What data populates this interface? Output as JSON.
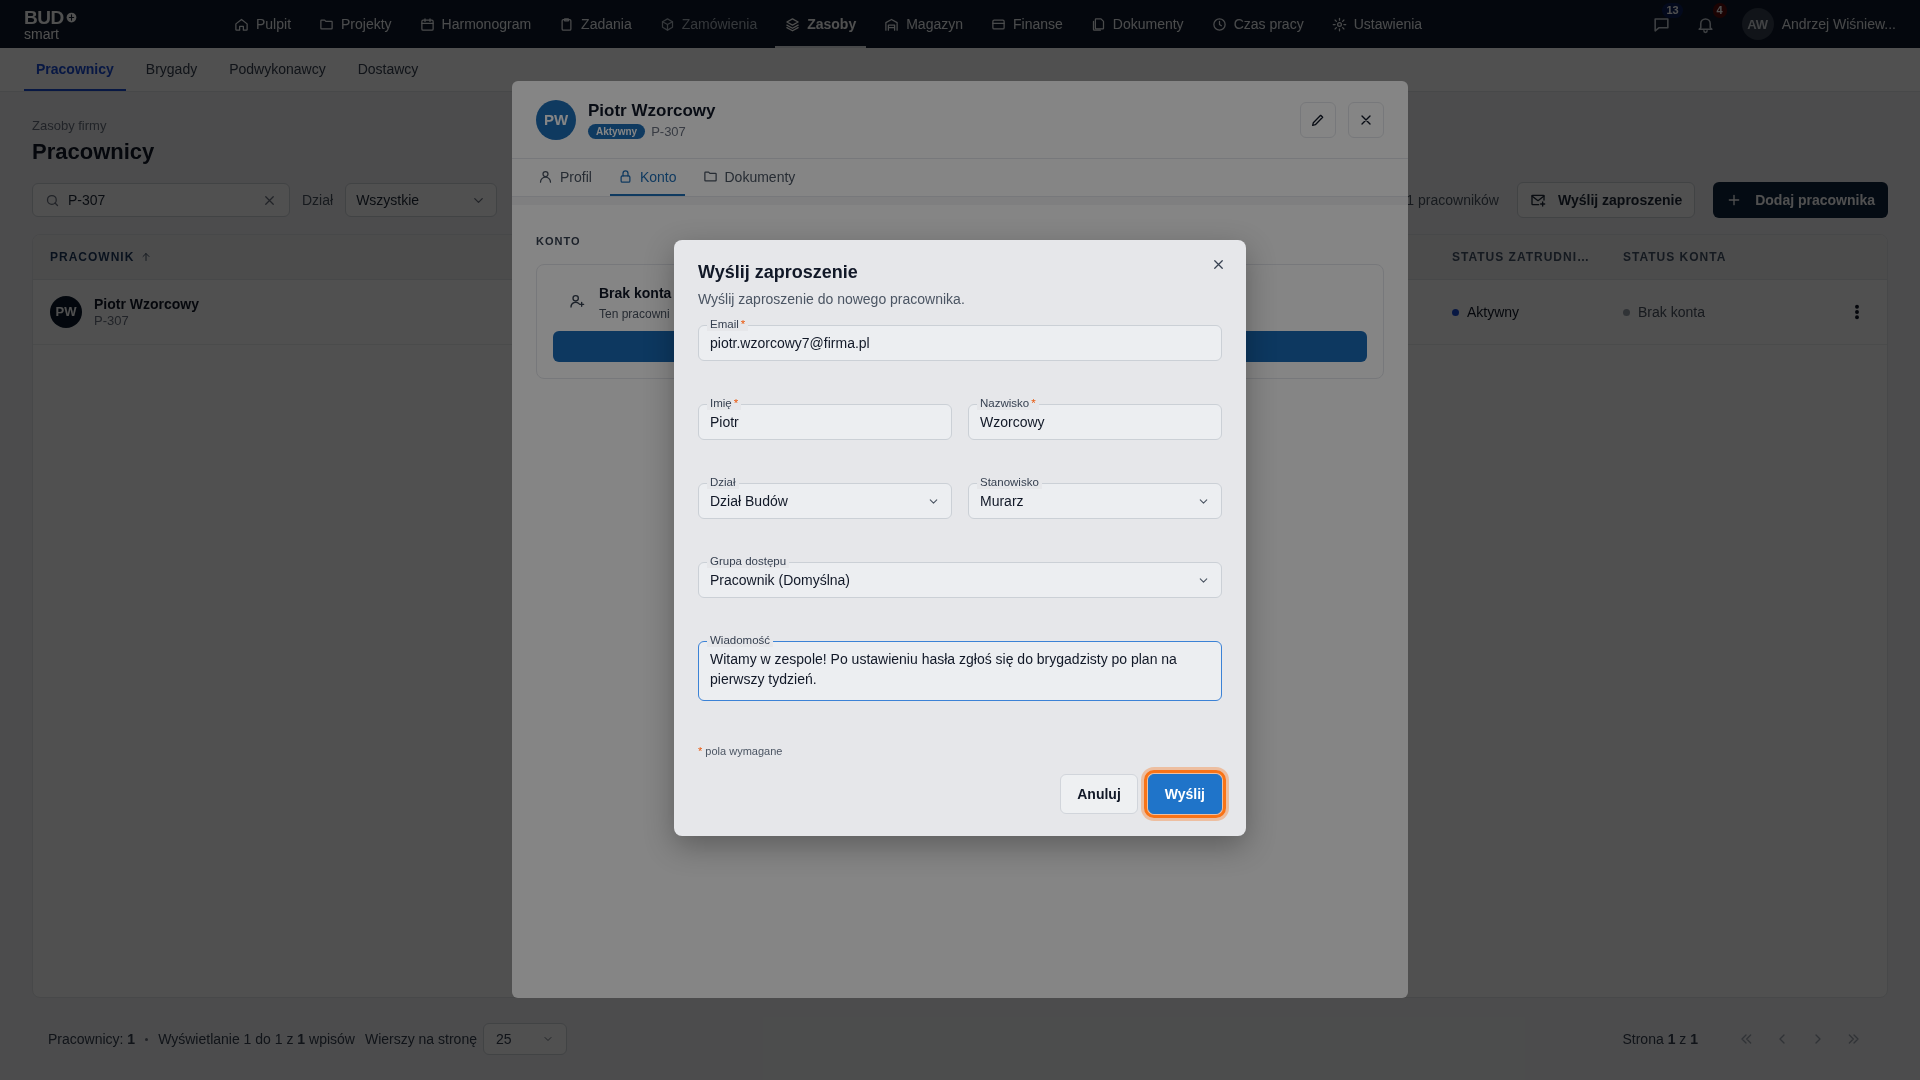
{
  "nav": {
    "logo_top": "BUD",
    "logo_bottom": "smart",
    "items": [
      {
        "label": "Pulpit",
        "selected": false,
        "disabled": false
      },
      {
        "label": "Projekty",
        "selected": false,
        "disabled": false
      },
      {
        "label": "Harmonogram",
        "selected": false,
        "disabled": false
      },
      {
        "label": "Zadania",
        "selected": false,
        "disabled": false
      },
      {
        "label": "Zamówienia",
        "selected": false,
        "disabled": true
      },
      {
        "label": "Zasoby",
        "selected": true,
        "disabled": false
      },
      {
        "label": "Magazyn",
        "selected": false,
        "disabled": false
      },
      {
        "label": "Finanse",
        "selected": false,
        "disabled": false
      },
      {
        "label": "Dokumenty",
        "selected": false,
        "disabled": false
      },
      {
        "label": "Czas pracy",
        "selected": false,
        "disabled": false
      },
      {
        "label": "Ustawienia",
        "selected": false,
        "disabled": false
      }
    ],
    "messages_count": "13",
    "notifications_count": "4",
    "user_initials": "AW",
    "user_name": "Andrzej Wiśniew..."
  },
  "subtabs": [
    {
      "label": "Pracownicy",
      "selected": true
    },
    {
      "label": "Brygady",
      "selected": false
    },
    {
      "label": "Podwykonawcy",
      "selected": false
    },
    {
      "label": "Dostawcy",
      "selected": false
    }
  ],
  "page": {
    "breadcrumb": "Zasoby firmy",
    "title": "Pracownicy",
    "search_value": "P-307",
    "filter_label": "Dział",
    "filter_value": "Wszystkie",
    "count": "1 pracowników",
    "invite_button": "Wyślij zaproszenie",
    "add_button": "Dodaj pracownika"
  },
  "table": {
    "columns": [
      {
        "label": "PRACOWNIK",
        "sorted": true
      },
      {
        "label": "STATUS ZATRUDNI…",
        "sorted": false
      },
      {
        "label": "STATUS KONTA",
        "sorted": false
      }
    ],
    "rows": [
      {
        "initials": "PW",
        "name": "Piotr Wzorcowy",
        "code": "P-307",
        "employment": {
          "label": "Aktywny",
          "kind": "active"
        },
        "account": {
          "label": "Brak konta",
          "kind": "none"
        }
      }
    ]
  },
  "footer": {
    "summary": "Pracownicy: **1**",
    "showing": "Wyświetlanie 1 do 1 z **1** wpisów",
    "rows_label": "Wierszy na stronę",
    "rows_value": "25",
    "page_info": "Strona **1** z **1**"
  },
  "drawer": {
    "initials": "PW",
    "name": "Piotr Wzorcowy",
    "status": "Aktywny",
    "code": "P-307",
    "tabs": [
      {
        "label": "Profil",
        "selected": false
      },
      {
        "label": "Konto",
        "selected": true
      },
      {
        "label": "Dokumenty",
        "selected": false
      }
    ],
    "section_title": "KONTO",
    "card_title": "Brak konta",
    "card_text": "Ten pracowni"
  },
  "modal": {
    "title": "Wyślij zaproszenie",
    "subtitle": "Wyślij zaproszenie do nowego pracownika.",
    "required_mark": "*",
    "rows": [
      [
        {
          "kind": "input",
          "label": "Email",
          "required": true,
          "focused": false,
          "value": "piotr.wzorcowy7@firma.pl"
        }
      ],
      [
        {
          "kind": "input",
          "label": "Imię",
          "required": true,
          "focused": false,
          "value": "Piotr"
        },
        {
          "kind": "input",
          "label": "Nazwisko",
          "required": true,
          "focused": false,
          "value": "Wzorcowy"
        }
      ],
      [
        {
          "kind": "select",
          "label": "Dział",
          "required": false,
          "focused": false,
          "value": "Dział Budów"
        },
        {
          "kind": "select",
          "label": "Stanowisko",
          "required": false,
          "focused": false,
          "value": "Murarz"
        }
      ],
      [
        {
          "kind": "select",
          "label": "Grupa dostępu",
          "required": false,
          "focused": false,
          "value": "Pracownik (Domyślna)"
        }
      ],
      [
        {
          "kind": "textarea",
          "label": "Wiadomość",
          "required": false,
          "focused": true,
          "value": "Witamy w zespole! Po ustawieniu hasła zgłoś się do brygadzisty po plan na pierwszy tydzień."
        }
      ]
    ],
    "required_note": "pola wymagane",
    "buttons": [
      {
        "label": "Anuluj",
        "kind": "secondary",
        "focused": false
      },
      {
        "label": "Wyślij",
        "kind": "primary",
        "focused": true
      }
    ]
  }
}
